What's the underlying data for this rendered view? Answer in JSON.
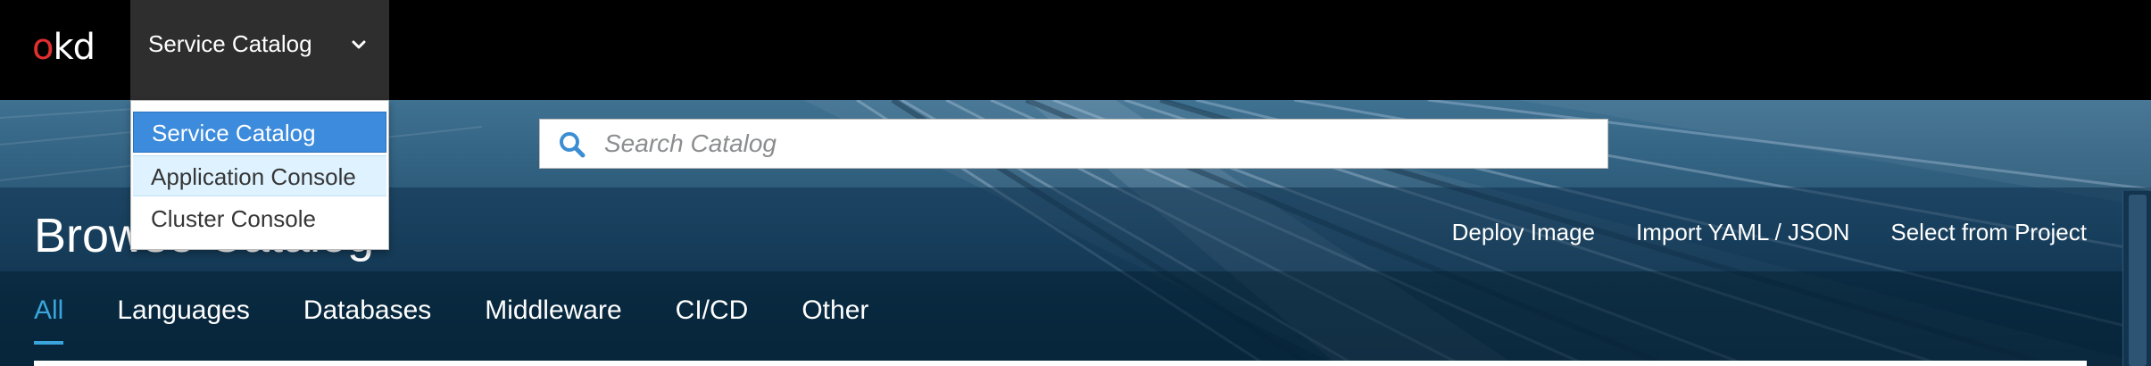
{
  "topbar": {
    "logo": {
      "prefix": "o",
      "rest": "kd"
    },
    "context_switcher": {
      "label": "Service Catalog",
      "icon": "chevron-down-icon"
    }
  },
  "context_menu": {
    "items": [
      {
        "label": "Service Catalog",
        "state": "selected"
      },
      {
        "label": "Application Console",
        "state": "hover"
      },
      {
        "label": "Cluster Console",
        "state": "normal"
      }
    ]
  },
  "search": {
    "placeholder": "Search Catalog",
    "value": "",
    "icon": "search-icon"
  },
  "page": {
    "title": "Browse Catalog"
  },
  "actions": {
    "deploy_image": "Deploy Image",
    "import_yaml": "Import YAML / JSON",
    "select_project": "Select from Project"
  },
  "categories": {
    "tabs": [
      {
        "label": "All",
        "active": true
      },
      {
        "label": "Languages",
        "active": false
      },
      {
        "label": "Databases",
        "active": false
      },
      {
        "label": "Middleware",
        "active": false
      },
      {
        "label": "CI/CD",
        "active": false
      },
      {
        "label": "Other",
        "active": false
      }
    ]
  },
  "colors": {
    "accent": "#39a5dc",
    "logo_red": "#e12e2e",
    "menu_selected": "#3c8bdc",
    "menu_hover": "#def3ff",
    "topbar": "#000000",
    "context_toggle": "#2e2e2e"
  }
}
